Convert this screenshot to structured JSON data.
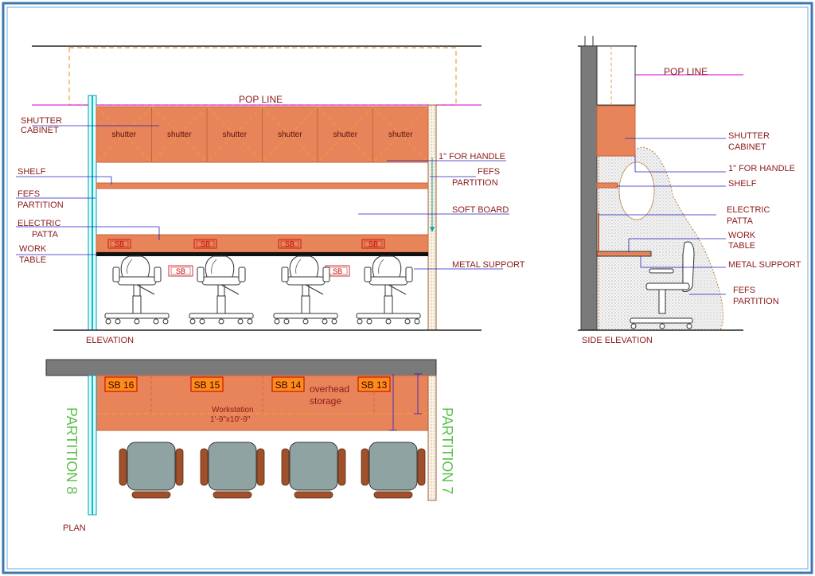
{
  "colors": {
    "frame": "#3a78b0",
    "cabinet": "#e8845a",
    "cabinet_dark": "#c8643a",
    "dashed": "#e8a040",
    "leader": "#2020c0",
    "pop_line": "#d000d0",
    "wall": "#7a7a7a",
    "text": "#8b1a1a",
    "partition_text": "#5cc14b",
    "chair_seat": "#8fa3a3",
    "chair_arm": "#a0502a"
  },
  "elevation": {
    "pop_line_label": "POP LINE",
    "shutters": [
      "shutter",
      "shutter",
      "shutter",
      "shutter",
      "shutter",
      "shutter"
    ],
    "sb_tags_upper": [
      "SB",
      "SB",
      "SB",
      "SB"
    ],
    "sb_tags_lower": [
      "SB",
      "SB"
    ],
    "labels_left": {
      "shutter_cabinet_1": "SHUTTER",
      "shutter_cabinet_2": "CABINET",
      "shelf": "SHELF",
      "fefs_partition_1": "FEFS",
      "fefs_partition_2": "PARTITION",
      "electric_patta_1": "ELECTRIC",
      "electric_patta_2": "PATTA",
      "work_table_1": "WORK",
      "work_table_2": "TABLE"
    },
    "labels_right": {
      "handle": "1\" FOR HANDLE",
      "fefs_partition_1": "FEFS",
      "fefs_partition_2": "PARTITION",
      "soft_board": "SOFT BOARD",
      "metal_support": "METAL SUPPORT"
    },
    "title": "ELEVATION"
  },
  "side_elevation": {
    "pop_line_label": "POP LINE",
    "labels": {
      "shutter_cabinet_1": "SHUTTER",
      "shutter_cabinet_2": "CABINET",
      "handle": "1\" FOR HANDLE",
      "shelf": "SHELF",
      "electric_patta_1": "ELECTRIC",
      "electric_patta_2": "PATTA",
      "work_table_1": "WORK",
      "work_table_2": "TABLE",
      "metal_support": "METAL SUPPORT",
      "fefs_partition_1": "FEFS",
      "fefs_partition_2": "PARTITION"
    },
    "title": "SIDE ELEVATION"
  },
  "plan": {
    "sb_boxes": [
      "SB 16",
      "SB 15",
      "SB 14",
      "SB 13"
    ],
    "overhead_1": "overhead",
    "overhead_2": "storage",
    "workstation_1": "Workstation",
    "workstation_2": "1'-9\"x10'-9\"",
    "partition_left": "PARTITION 8",
    "partition_right": "PARTITION 7",
    "title": "PLAN"
  }
}
